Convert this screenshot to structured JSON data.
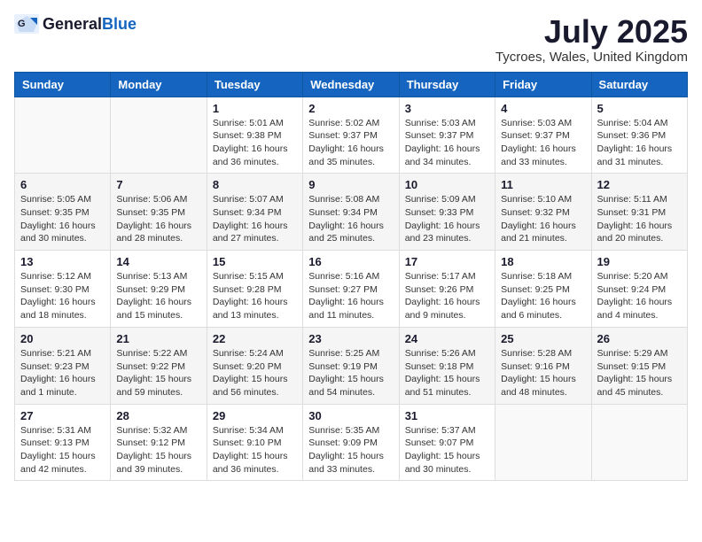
{
  "header": {
    "logo_general": "General",
    "logo_blue": "Blue",
    "title": "July 2025",
    "subtitle": "Tycroes, Wales, United Kingdom"
  },
  "weekdays": [
    "Sunday",
    "Monday",
    "Tuesday",
    "Wednesday",
    "Thursday",
    "Friday",
    "Saturday"
  ],
  "weeks": [
    [
      {
        "day": "",
        "detail": ""
      },
      {
        "day": "",
        "detail": ""
      },
      {
        "day": "1",
        "detail": "Sunrise: 5:01 AM\nSunset: 9:38 PM\nDaylight: 16 hours\nand 36 minutes."
      },
      {
        "day": "2",
        "detail": "Sunrise: 5:02 AM\nSunset: 9:37 PM\nDaylight: 16 hours\nand 35 minutes."
      },
      {
        "day": "3",
        "detail": "Sunrise: 5:03 AM\nSunset: 9:37 PM\nDaylight: 16 hours\nand 34 minutes."
      },
      {
        "day": "4",
        "detail": "Sunrise: 5:03 AM\nSunset: 9:37 PM\nDaylight: 16 hours\nand 33 minutes."
      },
      {
        "day": "5",
        "detail": "Sunrise: 5:04 AM\nSunset: 9:36 PM\nDaylight: 16 hours\nand 31 minutes."
      }
    ],
    [
      {
        "day": "6",
        "detail": "Sunrise: 5:05 AM\nSunset: 9:35 PM\nDaylight: 16 hours\nand 30 minutes."
      },
      {
        "day": "7",
        "detail": "Sunrise: 5:06 AM\nSunset: 9:35 PM\nDaylight: 16 hours\nand 28 minutes."
      },
      {
        "day": "8",
        "detail": "Sunrise: 5:07 AM\nSunset: 9:34 PM\nDaylight: 16 hours\nand 27 minutes."
      },
      {
        "day": "9",
        "detail": "Sunrise: 5:08 AM\nSunset: 9:34 PM\nDaylight: 16 hours\nand 25 minutes."
      },
      {
        "day": "10",
        "detail": "Sunrise: 5:09 AM\nSunset: 9:33 PM\nDaylight: 16 hours\nand 23 minutes."
      },
      {
        "day": "11",
        "detail": "Sunrise: 5:10 AM\nSunset: 9:32 PM\nDaylight: 16 hours\nand 21 minutes."
      },
      {
        "day": "12",
        "detail": "Sunrise: 5:11 AM\nSunset: 9:31 PM\nDaylight: 16 hours\nand 20 minutes."
      }
    ],
    [
      {
        "day": "13",
        "detail": "Sunrise: 5:12 AM\nSunset: 9:30 PM\nDaylight: 16 hours\nand 18 minutes."
      },
      {
        "day": "14",
        "detail": "Sunrise: 5:13 AM\nSunset: 9:29 PM\nDaylight: 16 hours\nand 15 minutes."
      },
      {
        "day": "15",
        "detail": "Sunrise: 5:15 AM\nSunset: 9:28 PM\nDaylight: 16 hours\nand 13 minutes."
      },
      {
        "day": "16",
        "detail": "Sunrise: 5:16 AM\nSunset: 9:27 PM\nDaylight: 16 hours\nand 11 minutes."
      },
      {
        "day": "17",
        "detail": "Sunrise: 5:17 AM\nSunset: 9:26 PM\nDaylight: 16 hours\nand 9 minutes."
      },
      {
        "day": "18",
        "detail": "Sunrise: 5:18 AM\nSunset: 9:25 PM\nDaylight: 16 hours\nand 6 minutes."
      },
      {
        "day": "19",
        "detail": "Sunrise: 5:20 AM\nSunset: 9:24 PM\nDaylight: 16 hours\nand 4 minutes."
      }
    ],
    [
      {
        "day": "20",
        "detail": "Sunrise: 5:21 AM\nSunset: 9:23 PM\nDaylight: 16 hours\nand 1 minute."
      },
      {
        "day": "21",
        "detail": "Sunrise: 5:22 AM\nSunset: 9:22 PM\nDaylight: 15 hours\nand 59 minutes."
      },
      {
        "day": "22",
        "detail": "Sunrise: 5:24 AM\nSunset: 9:20 PM\nDaylight: 15 hours\nand 56 minutes."
      },
      {
        "day": "23",
        "detail": "Sunrise: 5:25 AM\nSunset: 9:19 PM\nDaylight: 15 hours\nand 54 minutes."
      },
      {
        "day": "24",
        "detail": "Sunrise: 5:26 AM\nSunset: 9:18 PM\nDaylight: 15 hours\nand 51 minutes."
      },
      {
        "day": "25",
        "detail": "Sunrise: 5:28 AM\nSunset: 9:16 PM\nDaylight: 15 hours\nand 48 minutes."
      },
      {
        "day": "26",
        "detail": "Sunrise: 5:29 AM\nSunset: 9:15 PM\nDaylight: 15 hours\nand 45 minutes."
      }
    ],
    [
      {
        "day": "27",
        "detail": "Sunrise: 5:31 AM\nSunset: 9:13 PM\nDaylight: 15 hours\nand 42 minutes."
      },
      {
        "day": "28",
        "detail": "Sunrise: 5:32 AM\nSunset: 9:12 PM\nDaylight: 15 hours\nand 39 minutes."
      },
      {
        "day": "29",
        "detail": "Sunrise: 5:34 AM\nSunset: 9:10 PM\nDaylight: 15 hours\nand 36 minutes."
      },
      {
        "day": "30",
        "detail": "Sunrise: 5:35 AM\nSunset: 9:09 PM\nDaylight: 15 hours\nand 33 minutes."
      },
      {
        "day": "31",
        "detail": "Sunrise: 5:37 AM\nSunset: 9:07 PM\nDaylight: 15 hours\nand 30 minutes."
      },
      {
        "day": "",
        "detail": ""
      },
      {
        "day": "",
        "detail": ""
      }
    ]
  ]
}
